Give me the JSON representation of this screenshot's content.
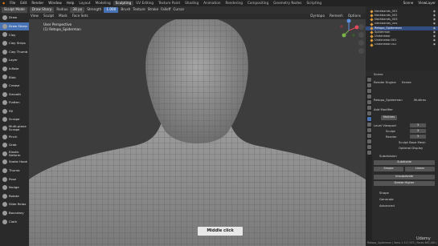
{
  "menubar": {
    "menus": [
      "File",
      "Edit",
      "Render",
      "Window",
      "Help"
    ],
    "workspace_tabs": [
      "Layout",
      "Modeling",
      "Sculpting",
      "UV Editing",
      "Texture Paint",
      "Shading",
      "Animation",
      "Rendering",
      "Compositing",
      "Geometry Nodes",
      "Scripting"
    ],
    "active_tab": "Sculpting",
    "scene": "Scene",
    "view_layer": "ViewLayer"
  },
  "toolbar": {
    "mode": "Sculpt Mode",
    "brush": "Draw Sharp",
    "radius_label": "Radius",
    "radius_value": "38 px",
    "strength_label": "Strength",
    "strength_value": "1.000",
    "brush_menu": "Brush",
    "texture_menu": "Texture",
    "stroke_menu": "Stroke",
    "falloff_menu": "Falloff",
    "cursor_menu": "Cursor"
  },
  "header2": {
    "items": [
      "View",
      "Sculpt",
      "Mask",
      "Face Sets"
    ],
    "dyntopo": "Dyntopo",
    "remesh": "Remesh",
    "options": "Options"
  },
  "tools": [
    {
      "label": "Draw",
      "active": false
    },
    {
      "label": "Draw Sharp",
      "active": true
    },
    {
      "label": "Clay",
      "active": false
    },
    {
      "label": "Clay Strips",
      "active": false
    },
    {
      "label": "Clay Thumb",
      "active": false
    },
    {
      "label": "Layer",
      "active": false
    },
    {
      "label": "Inflate",
      "active": false
    },
    {
      "label": "Blob",
      "active": false
    },
    {
      "label": "Crease",
      "active": false
    },
    {
      "label": "Smooth",
      "active": false
    },
    {
      "label": "Flatten",
      "active": false
    },
    {
      "label": "Fill",
      "active": false
    },
    {
      "label": "Scrape",
      "active": false
    },
    {
      "label": "Multi-plane Scrape",
      "active": false
    },
    {
      "label": "Pinch",
      "active": false
    },
    {
      "label": "Grab",
      "active": false
    },
    {
      "label": "Elastic Deform",
      "active": false
    },
    {
      "label": "Snake Hook",
      "active": false
    },
    {
      "label": "Thumb",
      "active": false
    },
    {
      "label": "Pose",
      "active": false
    },
    {
      "label": "Nudge",
      "active": false
    },
    {
      "label": "Rotate",
      "active": false
    },
    {
      "label": "Slide Relax",
      "active": false
    },
    {
      "label": "Boundary",
      "active": false
    },
    {
      "label": "Cloth",
      "active": false
    }
  ],
  "viewport": {
    "perspective": "User Perspective",
    "object": "(1) Retopo_Spiderman",
    "status_hint": "Middle click"
  },
  "outliner": {
    "rows": [
      {
        "label": "Neckbands_001",
        "selected": false
      },
      {
        "label": "Neckbands_002",
        "selected": false
      },
      {
        "label": "Neckbands_003",
        "selected": false
      },
      {
        "label": "Neckbands_004",
        "selected": false
      },
      {
        "label": "Retopo_Spiderman",
        "selected": true
      },
      {
        "label": "Spiderman",
        "selected": false
      },
      {
        "label": "Underwear",
        "selected": false
      },
      {
        "label": "Underwear.001",
        "selected": false
      },
      {
        "label": "Underwear.002",
        "selected": false
      }
    ]
  },
  "properties": {
    "scene_label": "Scene",
    "render_engine_label": "Render Engine",
    "render_engine_value": "Eevee",
    "object_name": "Retopo_Spiderman",
    "modifier_tab": "Multires",
    "add_modifier": "Add Modifier",
    "modifier_name": "Multires",
    "level_viewport_label": "Level Viewport",
    "level_viewport_value": "3",
    "sculpt_label": "Sculpt",
    "sculpt_value": "3",
    "render_label": "Render",
    "render_value": "3",
    "sculpt_base_mesh": "Sculpt Base Mesh",
    "optimal_display": "Optimal Display",
    "subdivision_section": "Subdivision",
    "subdivide_btn": "Subdivide",
    "simple_btn": "Simple",
    "linear_btn": "Linear",
    "unsubdivide_btn": "Unsubdivide",
    "delete_higher_btn": "Delete Higher",
    "shape_section": "Shape",
    "generate_section": "Generate",
    "advanced_section": "Advanced"
  },
  "statusbar": {
    "text": "Retopo_Spiderman | Verts 1,317,953 | Faces 663,480 | Tris 1,327,008"
  },
  "watermark": "Udemy"
}
